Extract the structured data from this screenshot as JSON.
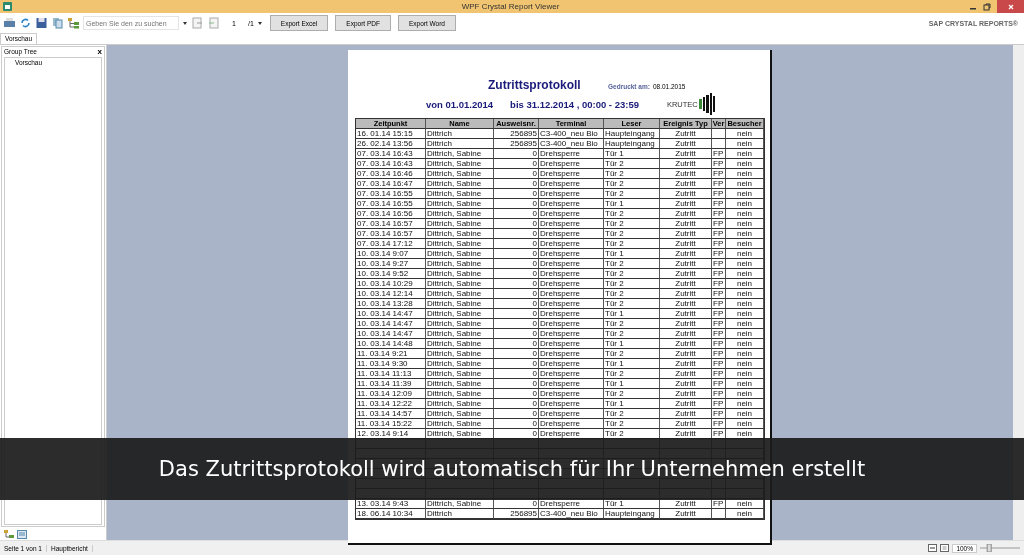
{
  "window": {
    "title": "WPF Crystal Report Viewer"
  },
  "toolbar": {
    "search": {
      "placeholder": "Geben Sie den zu suchen"
    },
    "page_field": {
      "value": "1"
    },
    "page_total": "/1",
    "buttons": [
      "Export Excel",
      "Export PDF",
      "Export Word"
    ],
    "brand": "SAP CRYSTAL REPORTS®"
  },
  "tabs": [
    {
      "label": "Vorschau",
      "selected": true
    }
  ],
  "group_tree": {
    "title": "Group Tree",
    "close": "x",
    "items": [
      {
        "label": "Vorschau",
        "selected": false
      }
    ]
  },
  "report": {
    "title": "Zutrittsprotokoll",
    "printed_label": "Gedruckt am:",
    "printed_date": "08.01.2015",
    "range_from": "von 01.01.2014",
    "range_to": "bis 31.12.2014 , 00:00 - 23:59",
    "logo_text": "KRUTEC",
    "columns": [
      "Zeitpunkt",
      "Name",
      "Ausweisnr.",
      "Terminal",
      "Leser",
      "Ereignis Typ",
      "Ver",
      "Besucher"
    ],
    "rows": [
      {
        "kind": "entry",
        "zeitpunkt": "16. 01.14 15:15",
        "name": "Dittrich",
        "ausweisnr": "256895",
        "terminal": "C3-400_neu Bio",
        "leser": "Haupteingang",
        "ereignis_typ": "Zutritt",
        "besucher": "nein"
      },
      {
        "kind": "entry",
        "zeitpunkt": "26. 02.14 13:56",
        "name": "Dittrich",
        "ausweisnr": "256895",
        "terminal": "C3-400_neu Bio",
        "leser": "Haupteingang",
        "ereignis_typ": "Zutritt",
        "besucher": "nein"
      },
      {
        "kind": "entry",
        "zeitpunkt": "07. 03.14 16:43",
        "name": "Dittrich, Sabine",
        "ausweisnr": "0",
        "terminal": "Drehsperre",
        "leser": "Tür 1",
        "ereignis_typ": "Zutritt",
        "ver": "FP",
        "besucher": "nein"
      },
      {
        "kind": "entry",
        "zeitpunkt": "07. 03.14 16:43",
        "name": "Dittrich, Sabine",
        "ausweisnr": "0",
        "terminal": "Drehsperre",
        "leser": "Tür 2",
        "ereignis_typ": "Zutritt",
        "ver": "FP",
        "besucher": "nein"
      },
      {
        "kind": "entry",
        "zeitpunkt": "07. 03.14 16:46",
        "name": "Dittrich, Sabine",
        "ausweisnr": "0",
        "terminal": "Drehsperre",
        "leser": "Tür 2",
        "ereignis_typ": "Zutritt",
        "ver": "FP",
        "besucher": "nein"
      },
      {
        "kind": "entry",
        "zeitpunkt": "07. 03.14 16:47",
        "name": "Dittrich, Sabine",
        "ausweisnr": "0",
        "terminal": "Drehsperre",
        "leser": "Tür 2",
        "ereignis_typ": "Zutritt",
        "ver": "FP",
        "besucher": "nein"
      },
      {
        "kind": "entry",
        "zeitpunkt": "07. 03.14 16:55",
        "name": "Dittrich, Sabine",
        "ausweisnr": "0",
        "terminal": "Drehsperre",
        "leser": "Tür 2",
        "ereignis_typ": "Zutritt",
        "ver": "FP",
        "besucher": "nein"
      },
      {
        "kind": "entry",
        "zeitpunkt": "07. 03.14 16:55",
        "name": "Dittrich, Sabine",
        "ausweisnr": "0",
        "terminal": "Drehsperre",
        "leser": "Tür 1",
        "ereignis_typ": "Zutritt",
        "ver": "FP",
        "besucher": "nein"
      },
      {
        "kind": "entry",
        "zeitpunkt": "07. 03.14 16:56",
        "name": "Dittrich, Sabine",
        "ausweisnr": "0",
        "terminal": "Drehsperre",
        "leser": "Tür 2",
        "ereignis_typ": "Zutritt",
        "ver": "FP",
        "besucher": "nein"
      },
      {
        "kind": "entry",
        "zeitpunkt": "07. 03.14 16:57",
        "name": "Dittrich, Sabine",
        "ausweisnr": "0",
        "terminal": "Drehsperre",
        "leser": "Tür 2",
        "ereignis_typ": "Zutritt",
        "ver": "FP",
        "besucher": "nein"
      },
      {
        "kind": "entry",
        "zeitpunkt": "07. 03.14 16:57",
        "name": "Dittrich, Sabine",
        "ausweisnr": "0",
        "terminal": "Drehsperre",
        "leser": "Tür 2",
        "ereignis_typ": "Zutritt",
        "ver": "FP",
        "besucher": "nein"
      },
      {
        "kind": "entry",
        "zeitpunkt": "07. 03.14 17:12",
        "name": "Dittrich, Sabine",
        "ausweisnr": "0",
        "terminal": "Drehsperre",
        "leser": "Tür 2",
        "ereignis_typ": "Zutritt",
        "ver": "FP",
        "besucher": "nein"
      },
      {
        "kind": "entry",
        "zeitpunkt": "10. 03.14 9:07",
        "name": "Dittrich, Sabine",
        "ausweisnr": "0",
        "terminal": "Drehsperre",
        "leser": "Tür 1",
        "ereignis_typ": "Zutritt",
        "ver": "FP",
        "besucher": "nein"
      },
      {
        "kind": "entry",
        "zeitpunkt": "10. 03.14 9:27",
        "name": "Dittrich, Sabine",
        "ausweisnr": "0",
        "terminal": "Drehsperre",
        "leser": "Tür 2",
        "ereignis_typ": "Zutritt",
        "ver": "FP",
        "besucher": "nein"
      },
      {
        "kind": "entry",
        "zeitpunkt": "10. 03.14 9:52",
        "name": "Dittrich, Sabine",
        "ausweisnr": "0",
        "terminal": "Drehsperre",
        "leser": "Tür 2",
        "ereignis_typ": "Zutritt",
        "ver": "FP",
        "besucher": "nein"
      },
      {
        "kind": "entry",
        "zeitpunkt": "10. 03.14 10:29",
        "name": "Dittrich, Sabine",
        "ausweisnr": "0",
        "terminal": "Drehsperre",
        "leser": "Tür 2",
        "ereignis_typ": "Zutritt",
        "ver": "FP",
        "besucher": "nein"
      },
      {
        "kind": "entry",
        "zeitpunkt": "10. 03.14 12:14",
        "name": "Dittrich, Sabine",
        "ausweisnr": "0",
        "terminal": "Drehsperre",
        "leser": "Tür 2",
        "ereignis_typ": "Zutritt",
        "ver": "FP",
        "besucher": "nein"
      },
      {
        "kind": "entry",
        "zeitpunkt": "10. 03.14 13:28",
        "name": "Dittrich, Sabine",
        "ausweisnr": "0",
        "terminal": "Drehsperre",
        "leser": "Tür 2",
        "ereignis_typ": "Zutritt",
        "ver": "FP",
        "besucher": "nein"
      },
      {
        "kind": "entry",
        "zeitpunkt": "10. 03.14 14:47",
        "name": "Dittrich, Sabine",
        "ausweisnr": "0",
        "terminal": "Drehsperre",
        "leser": "Tür 1",
        "ereignis_typ": "Zutritt",
        "ver": "FP",
        "besucher": "nein"
      },
      {
        "kind": "entry",
        "zeitpunkt": "10. 03.14 14:47",
        "name": "Dittrich, Sabine",
        "ausweisnr": "0",
        "terminal": "Drehsperre",
        "leser": "Tür 2",
        "ereignis_typ": "Zutritt",
        "ver": "FP",
        "besucher": "nein"
      },
      {
        "kind": "entry",
        "zeitpunkt": "10. 03.14 14:47",
        "name": "Dittrich, Sabine",
        "ausweisnr": "0",
        "terminal": "Drehsperre",
        "leser": "Tür 2",
        "ereignis_typ": "Zutritt",
        "ver": "FP",
        "besucher": "nein"
      },
      {
        "kind": "entry",
        "zeitpunkt": "10. 03.14 14:48",
        "name": "Dittrich, Sabine",
        "ausweisnr": "0",
        "terminal": "Drehsperre",
        "leser": "Tür 1",
        "ereignis_typ": "Zutritt",
        "ver": "FP",
        "besucher": "nein"
      },
      {
        "kind": "entry",
        "zeitpunkt": "11. 03.14 9:21",
        "name": "Dittrich, Sabine",
        "ausweisnr": "0",
        "terminal": "Drehsperre",
        "leser": "Tür 2",
        "ereignis_typ": "Zutritt",
        "ver": "FP",
        "besucher": "nein"
      },
      {
        "kind": "entry",
        "zeitpunkt": "11. 03.14 9:30",
        "name": "Dittrich, Sabine",
        "ausweisnr": "0",
        "terminal": "Drehsperre",
        "leser": "Tür 1",
        "ereignis_typ": "Zutritt",
        "ver": "FP",
        "besucher": "nein"
      },
      {
        "kind": "entry",
        "zeitpunkt": "11. 03.14 11:13",
        "name": "Dittrich, Sabine",
        "ausweisnr": "0",
        "terminal": "Drehsperre",
        "leser": "Tür 2",
        "ereignis_typ": "Zutritt",
        "ver": "FP",
        "besucher": "nein"
      },
      {
        "kind": "entry",
        "zeitpunkt": "11. 03.14 11:39",
        "name": "Dittrich, Sabine",
        "ausweisnr": "0",
        "terminal": "Drehsperre",
        "leser": "Tür 1",
        "ereignis_typ": "Zutritt",
        "ver": "FP",
        "besucher": "nein"
      },
      {
        "kind": "entry",
        "zeitpunkt": "11. 03.14 12:09",
        "name": "Dittrich, Sabine",
        "ausweisnr": "0",
        "terminal": "Drehsperre",
        "leser": "Tür 2",
        "ereignis_typ": "Zutritt",
        "ver": "FP",
        "besucher": "nein"
      },
      {
        "kind": "entry",
        "zeitpunkt": "11. 03.14 12:22",
        "name": "Dittrich, Sabine",
        "ausweisnr": "0",
        "terminal": "Drehsperre",
        "leser": "Tür 1",
        "ereignis_typ": "Zutritt",
        "ver": "FP",
        "besucher": "nein"
      },
      {
        "kind": "entry",
        "zeitpunkt": "11. 03.14 14:57",
        "name": "Dittrich, Sabine",
        "ausweisnr": "0",
        "terminal": "Drehsperre",
        "leser": "Tür 2",
        "ereignis_typ": "Zutritt",
        "ver": "FP",
        "besucher": "nein"
      },
      {
        "kind": "entry",
        "zeitpunkt": "11. 03.14 15:22",
        "name": "Dittrich, Sabine",
        "ausweisnr": "0",
        "terminal": "Drehsperre",
        "leser": "Tür 2",
        "ereignis_typ": "Zutritt",
        "ver": "FP",
        "besucher": "nein"
      },
      {
        "kind": "entry",
        "zeitpunkt": "12. 03.14 9:14",
        "name": "Dittrich, Sabine",
        "ausweisnr": "0",
        "terminal": "Drehsperre",
        "leser": "Tür 2",
        "ereignis_typ": "Zutritt",
        "ver": "FP",
        "besucher": "nein"
      },
      {
        "kind": "covered"
      },
      {
        "kind": "covered"
      },
      {
        "kind": "covered"
      },
      {
        "kind": "covered"
      },
      {
        "kind": "covered"
      },
      {
        "kind": "covered"
      },
      {
        "kind": "entry",
        "zeitpunkt": "13. 03.14 9:43",
        "name": "Dittrich, Sabine",
        "ausweisnr": "0",
        "terminal": "Drehsperre",
        "leser": "Tür 1",
        "ereignis_typ": "Zutritt",
        "ver": "FP",
        "besucher": "nein"
      },
      {
        "kind": "entry",
        "zeitpunkt": "18. 06.14 10:34",
        "name": "Dittrich",
        "ausweisnr": "256895",
        "terminal": "C3-400_neu Bio",
        "leser": "Haupteingang",
        "ereignis_typ": "Zutritt",
        "besucher": "nein"
      }
    ]
  },
  "caption": "Das Zutrittsprotokoll wird automatisch für Ihr Unternehmen erstellt",
  "status_bar": {
    "page": "Seite 1 von 1",
    "report": "Hauptbericht",
    "zoom": "100%",
    "zoom_slider": {
      "level": 0.2
    }
  }
}
